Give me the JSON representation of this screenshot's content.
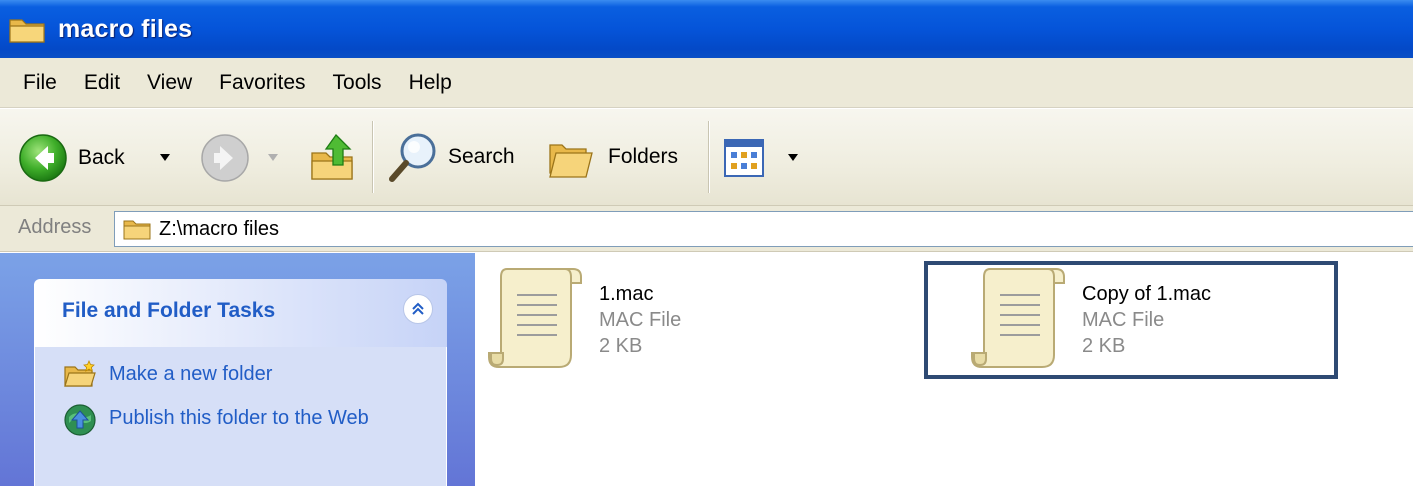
{
  "window": {
    "title": "macro files",
    "title_icon": "folder-icon"
  },
  "menu": {
    "items": [
      {
        "label": "File"
      },
      {
        "label": "Edit"
      },
      {
        "label": "View"
      },
      {
        "label": "Favorites"
      },
      {
        "label": "Tools"
      },
      {
        "label": "Help"
      }
    ]
  },
  "toolbar": {
    "back_label": "Back",
    "search_label": "Search",
    "folders_label": "Folders",
    "icons": [
      "back-arrow-icon",
      "forward-arrow-icon",
      "up-folder-icon",
      "search-icon",
      "folders-icon",
      "views-icon"
    ]
  },
  "address": {
    "label": "Address",
    "path": "Z:\\macro files"
  },
  "tasks_panel": {
    "title": "File and Folder Tasks",
    "items": [
      {
        "label": "Make a new folder",
        "icon": "new-folder-icon"
      },
      {
        "label": "Publish this folder to the Web",
        "icon": "publish-web-icon"
      }
    ]
  },
  "files": [
    {
      "name": "1.mac",
      "type": "MAC File",
      "size": "2 KB",
      "icon": "script-file-icon"
    },
    {
      "name": "Copy of 1.mac",
      "type": "MAC File",
      "size": "2 KB",
      "icon": "script-file-icon"
    }
  ],
  "colors": {
    "titlebar": "#0554d9",
    "menubar": "#ece9d8",
    "task_link": "#215dc6",
    "left_pane": "#6f8fdf",
    "highlight_border": "#2e4a73"
  }
}
